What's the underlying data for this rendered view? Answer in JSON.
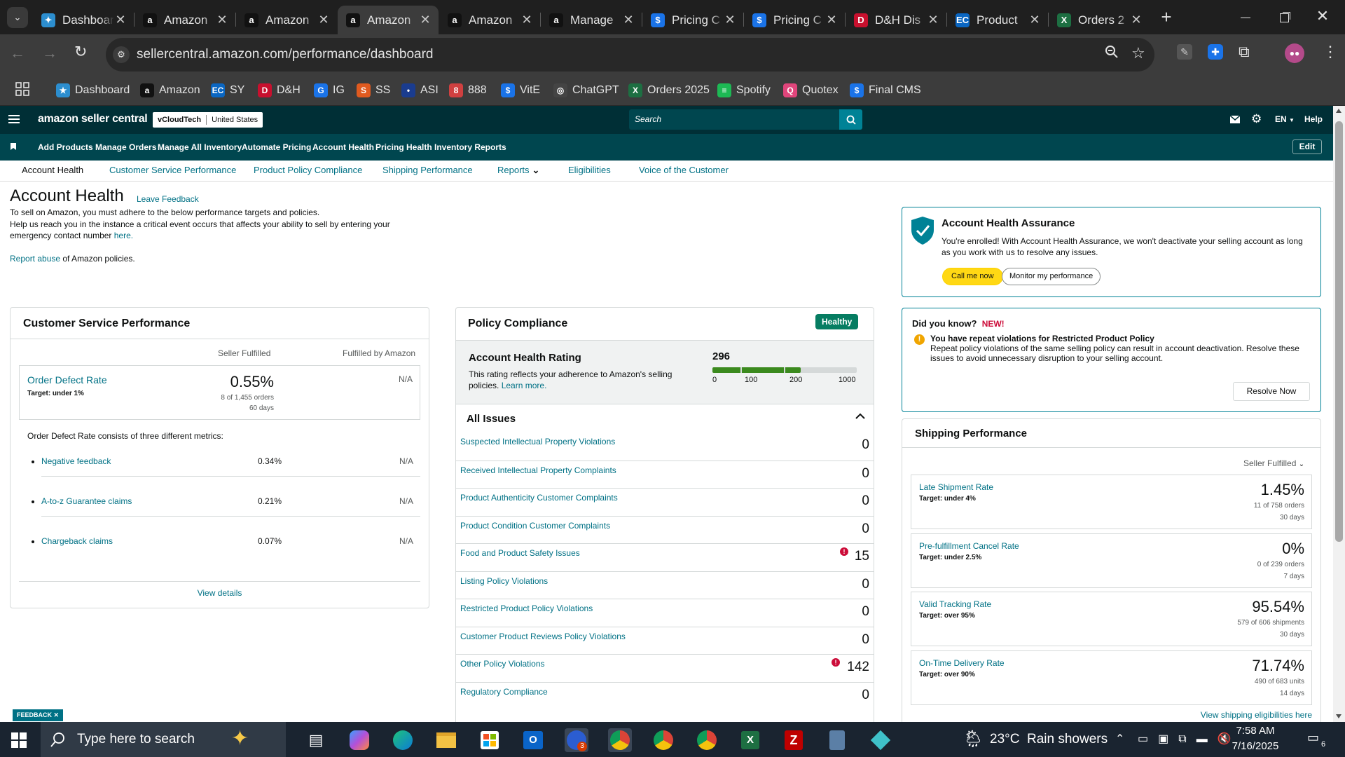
{
  "browser": {
    "tabs": [
      {
        "title": "Dashboard",
        "icon": "star-blue-icon",
        "color": "#2c8ecf"
      },
      {
        "title": "Amazon",
        "icon": "amazon-icon",
        "color": "#111111"
      },
      {
        "title": "Amazon",
        "icon": "amazon-icon",
        "color": "#111111"
      },
      {
        "title": "Amazon",
        "icon": "amazon-icon",
        "color": "#111111"
      },
      {
        "title": "Amazon",
        "icon": "amazon-icon",
        "color": "#111111"
      },
      {
        "title": "Manage",
        "icon": "amazon-icon",
        "color": "#111111"
      },
      {
        "title": "Pricing C",
        "icon": "dollar-icon",
        "color": "#1a73e8"
      },
      {
        "title": "Pricing C",
        "icon": "dollar-icon",
        "color": "#1a73e8"
      },
      {
        "title": "D&H Dis",
        "icon": "dh-icon",
        "color": "#c8102e"
      },
      {
        "title": "Product",
        "icon": "ec-icon",
        "color": "#0a66c2"
      },
      {
        "title": "Orders 2",
        "icon": "excel-icon",
        "color": "#1d6f42"
      }
    ],
    "url": "sellercentral.amazon.com/performance/dashboard",
    "bookmarks": [
      {
        "label": "Dashboard",
        "color": "#2c8ecf",
        "glyph": "★"
      },
      {
        "label": "Amazon",
        "color": "#111111",
        "glyph": "a"
      },
      {
        "label": "SY",
        "color": "#0a66c2",
        "glyph": "EC"
      },
      {
        "label": "D&H",
        "color": "#c8102e",
        "glyph": "D"
      },
      {
        "label": "IG",
        "color": "#1a73e8",
        "glyph": "G"
      },
      {
        "label": "SS",
        "color": "#e05a1f",
        "glyph": "S"
      },
      {
        "label": "ASI",
        "color": "#1a3c8f",
        "glyph": "•"
      },
      {
        "label": "888",
        "color": "#d04040",
        "glyph": "8"
      },
      {
        "label": "VitE",
        "color": "#1a73e8",
        "glyph": "$"
      },
      {
        "label": "ChatGPT",
        "color": "#444444",
        "glyph": "◎"
      },
      {
        "label": "Orders 2025",
        "color": "#1d6f42",
        "glyph": "X"
      },
      {
        "label": "Spotify",
        "color": "#1db954",
        "glyph": "≡"
      },
      {
        "label": "Quotex",
        "color": "#e0457b",
        "glyph": "Q"
      },
      {
        "label": "Final CMS",
        "color": "#1a73e8",
        "glyph": "$"
      }
    ]
  },
  "sc": {
    "logo": "amazon seller central",
    "store": "vCloudTech",
    "marketplace": "United States",
    "search_placeholder": "Search",
    "lang": "EN",
    "help": "Help",
    "nav": [
      "Add Products",
      "Manage Orders",
      "Manage All Inventory",
      "Automate Pricing",
      "Account Health",
      "Pricing Health",
      "Inventory Reports"
    ],
    "edit": "Edit",
    "subnav": [
      "Account Health",
      "Customer Service Performance",
      "Product Policy Compliance",
      "Shipping Performance",
      "Reports",
      "Eligibilities",
      "Voice of the Customer"
    ]
  },
  "header": {
    "title": "Account Health",
    "leave_feedback": "Leave Feedback",
    "line1": "To sell on Amazon, you must adhere to the below performance targets and policies.",
    "line2": "Help us reach you in the instance a critical event occurs that affects your ability to sell by entering your",
    "line3": "emergency contact number",
    "here": "here.",
    "report_abuse": "Report abuse",
    "report_rest": " of Amazon policies."
  },
  "csp": {
    "title": "Customer Service Performance",
    "col_sf": "Seller Fulfilled",
    "col_fba": "Fulfilled by Amazon",
    "odr_label": "Order Defect Rate",
    "odr_target": "Target: under 1%",
    "odr_value": "0.55%",
    "odr_detail": "8 of 1,455 orders",
    "odr_days": "60 days",
    "odr_fba": "N/A",
    "consists": "Order Defect Rate consists of three different metrics:",
    "metrics": [
      {
        "label": "Negative feedback",
        "sf": "0.34%",
        "fba": "N/A"
      },
      {
        "label": "A-to-z Guarantee claims",
        "sf": "0.21%",
        "fba": "N/A"
      },
      {
        "label": "Chargeback claims",
        "sf": "0.07%",
        "fba": "N/A"
      }
    ],
    "view_details": "View details"
  },
  "policy": {
    "title": "Policy Compliance",
    "badge": "Healthy",
    "ahr_title": "Account Health Rating",
    "ahr_desc1": "This rating reflects your adherence to Amazon's selling",
    "ahr_desc2": "policies.",
    "learn_more": "Learn more.",
    "ahr_value": "296",
    "ahr_fraction": 0.296,
    "scale": [
      "0",
      "100",
      "200",
      "1000"
    ],
    "all_issues": "All Issues",
    "issues": [
      {
        "label": "Suspected Intellectual Property Violations",
        "count": "0",
        "alert": false
      },
      {
        "label": "Received Intellectual Property Complaints",
        "count": "0",
        "alert": false
      },
      {
        "label": "Product Authenticity Customer Complaints",
        "count": "0",
        "alert": false
      },
      {
        "label": "Product Condition Customer Complaints",
        "count": "0",
        "alert": false
      },
      {
        "label": "Food and Product Safety Issues",
        "count": "15",
        "alert": true
      },
      {
        "label": "Listing Policy Violations",
        "count": "0",
        "alert": false
      },
      {
        "label": "Restricted Product Policy Violations",
        "count": "0",
        "alert": false
      },
      {
        "label": "Customer Product Reviews Policy Violations",
        "count": "0",
        "alert": false
      },
      {
        "label": "Other Policy Violations",
        "count": "142",
        "alert": true
      },
      {
        "label": "Regulatory Compliance",
        "count": "0",
        "alert": false
      }
    ]
  },
  "aha": {
    "title": "Account Health Assurance",
    "desc": "You're enrolled! With Account Health Assurance, we won't deactivate your selling account as long as you work with us to resolve any issues.",
    "call": "Call me now",
    "monitor": "Monitor my performance"
  },
  "dyk": {
    "title": "Did you know?",
    "new": "NEW!",
    "bold": "You have repeat violations for Restricted Product Policy",
    "desc": "Repeat policy violations of the same selling policy can result in account deactivation. Resolve these issues to avoid unnecessary disruption to your selling account.",
    "resolve": "Resolve Now"
  },
  "ship": {
    "title": "Shipping Performance",
    "filter": "Seller Fulfilled",
    "metrics": [
      {
        "label": "Late Shipment Rate",
        "target": "Target: under 4%",
        "value": "1.45%",
        "detail": "11 of 758 orders",
        "days": "30 days"
      },
      {
        "label": "Pre-fulfillment Cancel Rate",
        "target": "Target: under 2.5%",
        "value": "0%",
        "detail": "0 of 239 orders",
        "days": "7 days"
      },
      {
        "label": "Valid Tracking Rate",
        "target": "Target: over 95%",
        "value": "95.54%",
        "detail": "579 of 606 shipments",
        "days": "30 days"
      },
      {
        "label": "On-Time Delivery Rate",
        "target": "Target: over 90%",
        "value": "71.74%",
        "detail": "490 of 683 units",
        "days": "14 days"
      }
    ],
    "view_elig": "View shipping eligibilities here"
  },
  "feedback": "FEEDBACK",
  "taskbar": {
    "search": "Type here to search",
    "weather": "23°C  Rain showers",
    "time": "7:58 AM",
    "date": "7/16/2025",
    "notif_count": "6",
    "outlook_badge": "3"
  }
}
